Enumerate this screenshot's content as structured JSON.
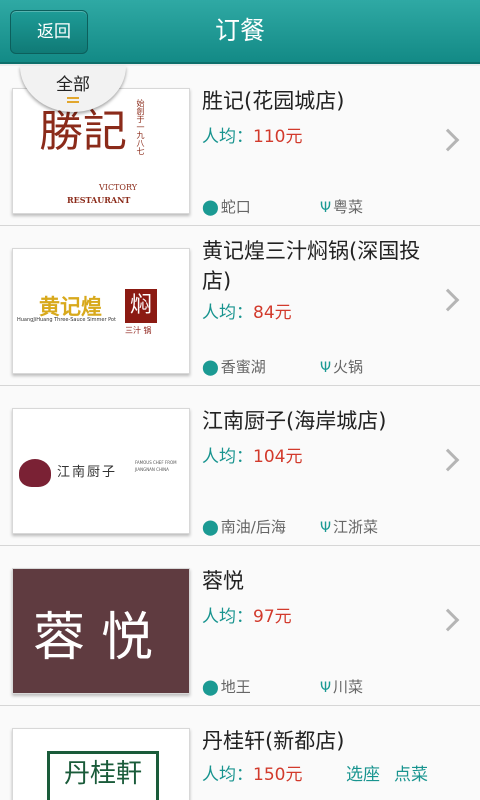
{
  "header": {
    "back_label": "返回",
    "title": "订餐"
  },
  "filter": {
    "label": "全部"
  },
  "restaurants": [
    {
      "name": "胜记(花园城店)",
      "price_label": "人均：",
      "price": "110元",
      "area": "蛇口",
      "cuisine": "粤菜",
      "logo": {
        "big": "勝記",
        "small": "始創于一九八七",
        "en1": "VICTORY",
        "en2": "RESTAURANT"
      }
    },
    {
      "name": "黄记煌三汁焖锅(深国投店)",
      "price_label": "人均：",
      "price": "84元",
      "area": "香蜜湖",
      "cuisine": "火锅",
      "logo": {
        "big": "黄记煌",
        "sub": "HuangJiHuang Three-Sauce Simmer Pot",
        "mark": "焖",
        "tail": "三汁 锅"
      }
    },
    {
      "name": "江南厨子(海岸城店)",
      "price_label": "人均：",
      "price": "104元",
      "area": "南油/后海",
      "cuisine": "江浙菜",
      "logo": {
        "big": "江南厨子",
        "en": "FAMOUS CHEF FROM JIANGNAN CHINA"
      }
    },
    {
      "name": "蓉悦",
      "price_label": "人均：",
      "price": "97元",
      "area": "地王",
      "cuisine": "川菜",
      "logo": {
        "big": "蓉悦"
      }
    },
    {
      "name": "丹桂轩(新都店)",
      "price_label": "人均：",
      "price": "150元",
      "action1": "选座",
      "action2": "点菜",
      "logo": {
        "big": "丹桂軒"
      }
    }
  ],
  "colors": {
    "header": "#1d9994",
    "price": "#d23a2c",
    "teal": "#18948f"
  }
}
